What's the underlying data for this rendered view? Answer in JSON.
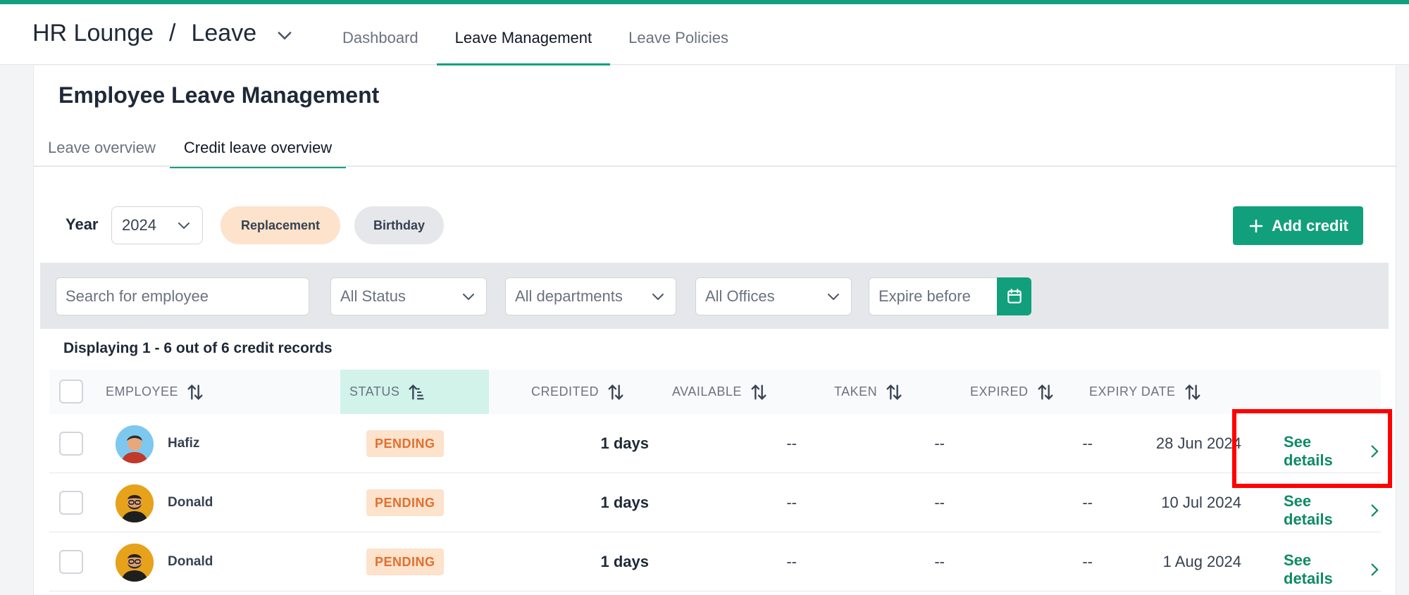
{
  "app": {
    "brand": "HR Lounge",
    "separator": "/",
    "module": "Leave"
  },
  "nav": {
    "tabs": [
      "Dashboard",
      "Leave Management",
      "Leave Policies"
    ],
    "active": "Leave Management"
  },
  "page": {
    "title": "Employee Leave Management",
    "subtabs": [
      "Leave overview",
      "Credit leave overview"
    ],
    "active_subtab": "Credit leave overview"
  },
  "controls": {
    "year_label": "Year",
    "year_value": "2024",
    "pill_replacement": "Replacement",
    "pill_birthday": "Birthday",
    "add_credit": "Add credit"
  },
  "filters": {
    "search_placeholder": "Search for employee",
    "status": "All Status",
    "departments": "All departments",
    "offices": "All Offices",
    "expire_before": "Expire before"
  },
  "table": {
    "count_text": "Displaying 1 - 6 out of 6 credit records",
    "headers": {
      "employee": "EMPLOYEE",
      "status": "STATUS",
      "credited": "CREDITED",
      "available": "AVAILABLE",
      "taken": "TAKEN",
      "expired": "EXPIRED",
      "expiry_date": "EXPIRY DATE"
    },
    "rows": [
      {
        "name": "Hafiz",
        "status": "PENDING",
        "credited": "1 days",
        "available": "--",
        "taken": "--",
        "expired": "--",
        "expiry": "28 Jun 2024",
        "action": "See details"
      },
      {
        "name": "Donald",
        "status": "PENDING",
        "credited": "1 days",
        "available": "--",
        "taken": "--",
        "expired": "--",
        "expiry": "10 Jul 2024",
        "action": "See details"
      },
      {
        "name": "Donald",
        "status": "PENDING",
        "credited": "1 days",
        "available": "--",
        "taken": "--",
        "expired": "--",
        "expiry": "1 Aug 2024",
        "action": "See details"
      }
    ]
  },
  "colors": {
    "accent": "#13a07d",
    "pending_bg": "#fde2cc",
    "pending_text": "#e0702f",
    "highlight": "#ff0000"
  }
}
